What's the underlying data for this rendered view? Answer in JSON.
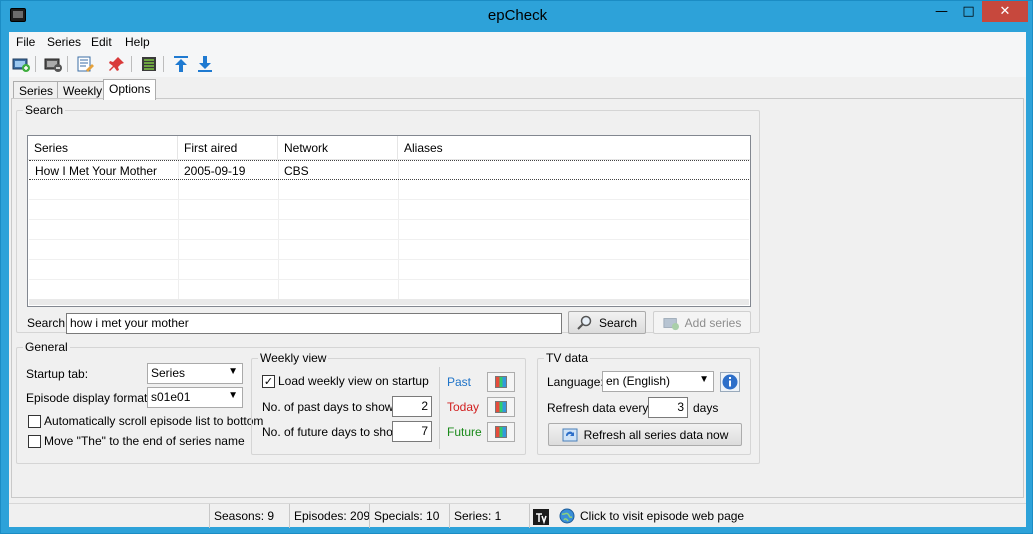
{
  "window": {
    "title": "epCheck"
  },
  "menu": [
    "File",
    "Series",
    "Edit",
    "Help"
  ],
  "tabs": [
    "Series",
    "Weekly",
    "Options"
  ],
  "search": {
    "group_label": "Search",
    "columns": [
      "Series",
      "First aired",
      "Network",
      "Aliases"
    ],
    "rows": [
      {
        "series": "How I Met Your Mother",
        "first_aired": "2005-09-19",
        "network": "CBS",
        "aliases": ""
      }
    ],
    "label": "Search:",
    "value": "how  i  met  your  mother",
    "search_button": "Search",
    "add_button": "Add series"
  },
  "general": {
    "group_label": "General",
    "startup_tab_label": "Startup tab:",
    "startup_tab_value": "Series",
    "episode_format_label": "Episode display format:",
    "episode_format_value": "s01e01",
    "auto_scroll_label": "Automatically scroll episode list to bottom",
    "auto_scroll_checked": false,
    "move_the_label": "Move \"The\" to the end of series name",
    "move_the_checked": false
  },
  "weekly": {
    "group_label": "Weekly view",
    "load_label": "Load weekly view on startup",
    "load_checked": true,
    "past_days_label": "No. of past days to show:",
    "past_days_value": "2",
    "future_days_label": "No. of future days to show:",
    "future_days_value": "7",
    "past_label": "Past",
    "today_label": "Today",
    "future_label": "Future",
    "colors": {
      "past": "#1e73c8",
      "today": "#d11f1f",
      "future": "#1a8a1a"
    }
  },
  "tvdata": {
    "group_label": "TV data",
    "language_label": "Language:",
    "language_value": "en (English)",
    "refresh_label": "Refresh data every:",
    "refresh_value": "3",
    "refresh_unit": "days",
    "refresh_button": "Refresh all series data now"
  },
  "status": {
    "seasons": "Seasons: 9",
    "episodes": "Episodes: 209",
    "specials": "Specials: 10",
    "series": "Series: 1",
    "visit_link": "Click to visit episode web page"
  }
}
